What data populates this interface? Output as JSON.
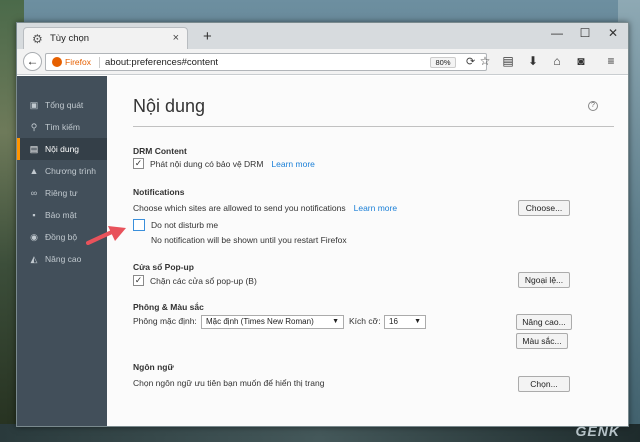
{
  "tab": {
    "title": "Tùy chọn",
    "close": "×",
    "new": "+"
  },
  "window_controls": {
    "minimize": "—",
    "maximize": "☐",
    "close": "✕"
  },
  "navbar": {
    "identity": "Firefox",
    "url": "about:preferences#content",
    "zoom": "80%"
  },
  "icons": {
    "back": "back-arrow-icon",
    "reload": "reload-icon",
    "bookmark": "star-icon",
    "reading": "reading-list-icon",
    "download": "download-icon",
    "home": "home-icon",
    "pocket": "pocket-icon",
    "menu": "hamburger-menu-icon"
  },
  "sidebar": {
    "items": [
      {
        "label": "Tổng quát",
        "icon": "general-icon"
      },
      {
        "label": "Tìm kiếm",
        "icon": "search-icon"
      },
      {
        "label": "Nội dung",
        "icon": "content-icon",
        "active": true
      },
      {
        "label": "Chương trình",
        "icon": "applications-icon"
      },
      {
        "label": "Riêng tư",
        "icon": "privacy-mask-icon"
      },
      {
        "label": "Bảo mật",
        "icon": "lock-icon"
      },
      {
        "label": "Đồng bộ",
        "icon": "sync-icon"
      },
      {
        "label": "Nâng cao",
        "icon": "advanced-icon"
      }
    ]
  },
  "main": {
    "title": "Nội dung",
    "help": "?",
    "drm": {
      "heading": "DRM Content",
      "checkbox_label": "Phát nội dung có bảo vệ DRM",
      "checked": true,
      "learn_more": "Learn more"
    },
    "notifications": {
      "heading": "Notifications",
      "description": "Choose which sites are allowed to send you notifications",
      "learn_more": "Learn more",
      "choose_button": "Choose...",
      "dnd_label": "Do not disturb me",
      "dnd_checked": false,
      "dnd_note": "No notification will be shown until you restart Firefox"
    },
    "popup": {
      "heading": "Cửa sổ Pop-up",
      "checkbox_label": "Chặn các cửa sổ pop-up (B)",
      "checked": true,
      "exceptions_button": "Ngoại lệ..."
    },
    "fonts": {
      "heading": "Phông & Màu sắc",
      "default_label": "Phông mặc định:",
      "default_value": "Mặc định (Times New Roman)",
      "size_label": "Kích cỡ:",
      "size_value": "16",
      "advanced_button": "Nâng cao...",
      "colors_button": "Màu sắc..."
    },
    "languages": {
      "heading": "Ngôn ngữ",
      "description": "Chọn ngôn ngữ ưu tiên bạn muốn để hiển thị trang",
      "choose_button": "Chọn..."
    }
  },
  "watermark": {
    "a": "GEN",
    "b": "K"
  },
  "colors": {
    "accent": "#ff9500",
    "link": "#1a7fd7",
    "sidebar": "#424f5a",
    "arrow": "#e8525b"
  }
}
